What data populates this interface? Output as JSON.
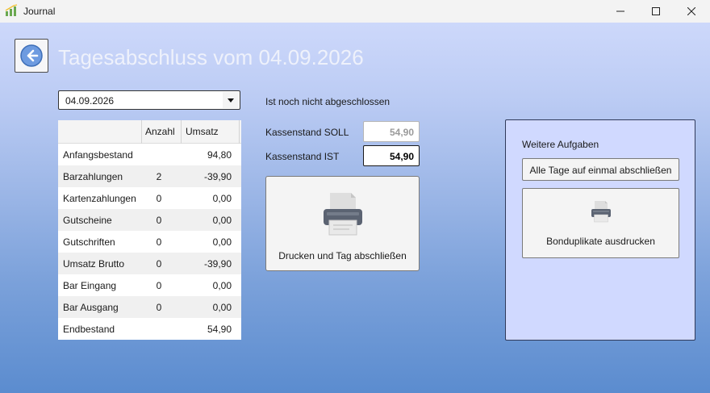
{
  "window": {
    "title": "Journal"
  },
  "page": {
    "title": "Tagesabschluss vom 04.09.2026"
  },
  "date_select": {
    "value": "04.09.2026"
  },
  "table": {
    "headers": [
      "Anzahl",
      "Umsatz"
    ],
    "rows": [
      {
        "label": "Anfangsbestand",
        "count": "",
        "amount": "94,80"
      },
      {
        "label": "Barzahlungen",
        "count": "2",
        "amount": "-39,90"
      },
      {
        "label": "Kartenzahlungen",
        "count": "0",
        "amount": "0,00"
      },
      {
        "label": "Gutscheine",
        "count": "0",
        "amount": "0,00"
      },
      {
        "label": "Gutschriften",
        "count": "0",
        "amount": "0,00"
      },
      {
        "label": "Umsatz Brutto",
        "count": "0",
        "amount": "-39,90"
      },
      {
        "label": "Bar Eingang",
        "count": "0",
        "amount": "0,00"
      },
      {
        "label": "Bar Ausgang",
        "count": "0",
        "amount": "0,00"
      },
      {
        "label": "Endbestand",
        "count": "",
        "amount": "54,90"
      }
    ]
  },
  "status": {
    "text": "Ist noch nicht abgeschlossen"
  },
  "kassenstand": {
    "soll_label": "Kassenstand SOLL",
    "soll_value": "54,90",
    "ist_label": "Kassenstand IST",
    "ist_value": "54,90"
  },
  "actions": {
    "print_close_label": "Drucken und Tag abschließen"
  },
  "panel": {
    "title": "Weitere Aufgaben",
    "close_all_label": "Alle Tage auf einmal abschließen",
    "duplicates_label": "Bonduplikate ausdrucken"
  },
  "icons": {
    "app": "bar-chart-icon",
    "back": "arrow-left-icon",
    "print": "printer-icon",
    "dropdown": "chevron-down-icon"
  },
  "colors": {
    "accent": "#5b8ccf",
    "panel_bg": "#d0d9ff",
    "title_text": "#eef1fb"
  }
}
